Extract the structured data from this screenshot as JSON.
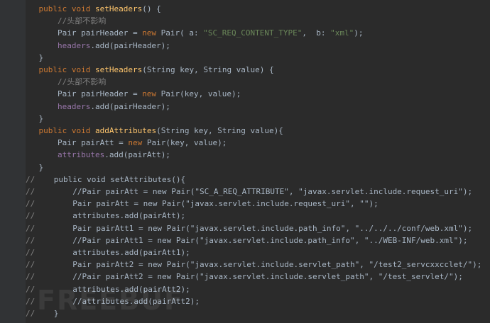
{
  "editor": {
    "theme": {
      "background": "#2b2b2b",
      "keyword": "#cc7832",
      "method": "#ffc66d",
      "field": "#9876aa",
      "string": "#6a8759",
      "comment": "#808080"
    },
    "lines": [
      {
        "t": "    public void setHeaders() {"
      },
      {
        "t": "        //头部不影响"
      },
      {
        "t": "        Pair pairHeader = new Pair( a: \"SC_REQ_CONTENT_TYPE\",  b: \"xml\");"
      },
      {
        "t": "        headers.add(pairHeader);"
      },
      {
        "t": "    }"
      },
      {
        "t": "    public void setHeaders(String key, String value) {"
      },
      {
        "t": "        //头部不影响"
      },
      {
        "t": "        Pair pairHeader = new Pair(key, value);"
      },
      {
        "t": "        headers.add(pairHeader);"
      },
      {
        "t": "    }"
      },
      {
        "t": "    public void addAttributes(String key, String value){"
      },
      {
        "t": "        Pair pairAtt = new Pair(key, value);"
      },
      {
        "t": "        attributes.add(pairAtt);"
      },
      {
        "t": "    }"
      },
      {
        "t": "//    public void setAttributes(){"
      },
      {
        "t": "//        //Pair pairAtt = new Pair(\"SC_A_REQ_ATTRIBUTE\", \"javax.servlet.include.request_uri\");"
      },
      {
        "t": "//        Pair pairAtt = new Pair(\"javax.servlet.include.request_uri\", \"\");"
      },
      {
        "t": "//        attributes.add(pairAtt);"
      },
      {
        "t": "//        Pair pairAtt1 = new Pair(\"javax.servlet.include.path_info\", \"../../../conf/web.xml\");"
      },
      {
        "t": "//        //Pair pairAtt1 = new Pair(\"javax.servlet.include.path_info\", \"../WEB-INF/web.xml\");"
      },
      {
        "t": "//        attributes.add(pairAtt1);"
      },
      {
        "t": "//        Pair pairAtt2 = new Pair(\"javax.servlet.include.servlet_path\", \"/test2_servcxxcclet/\");"
      },
      {
        "t": "//        //Pair pairAtt2 = new Pair(\"javax.servlet.include.servlet_path\", \"/test_servlet/\");"
      },
      {
        "t": "//        attributes.add(pairAtt2);"
      },
      {
        "t": "//        //attributes.add(pairAtt2);"
      },
      {
        "t": "//    }"
      }
    ]
  },
  "watermark": "FREEBUF"
}
